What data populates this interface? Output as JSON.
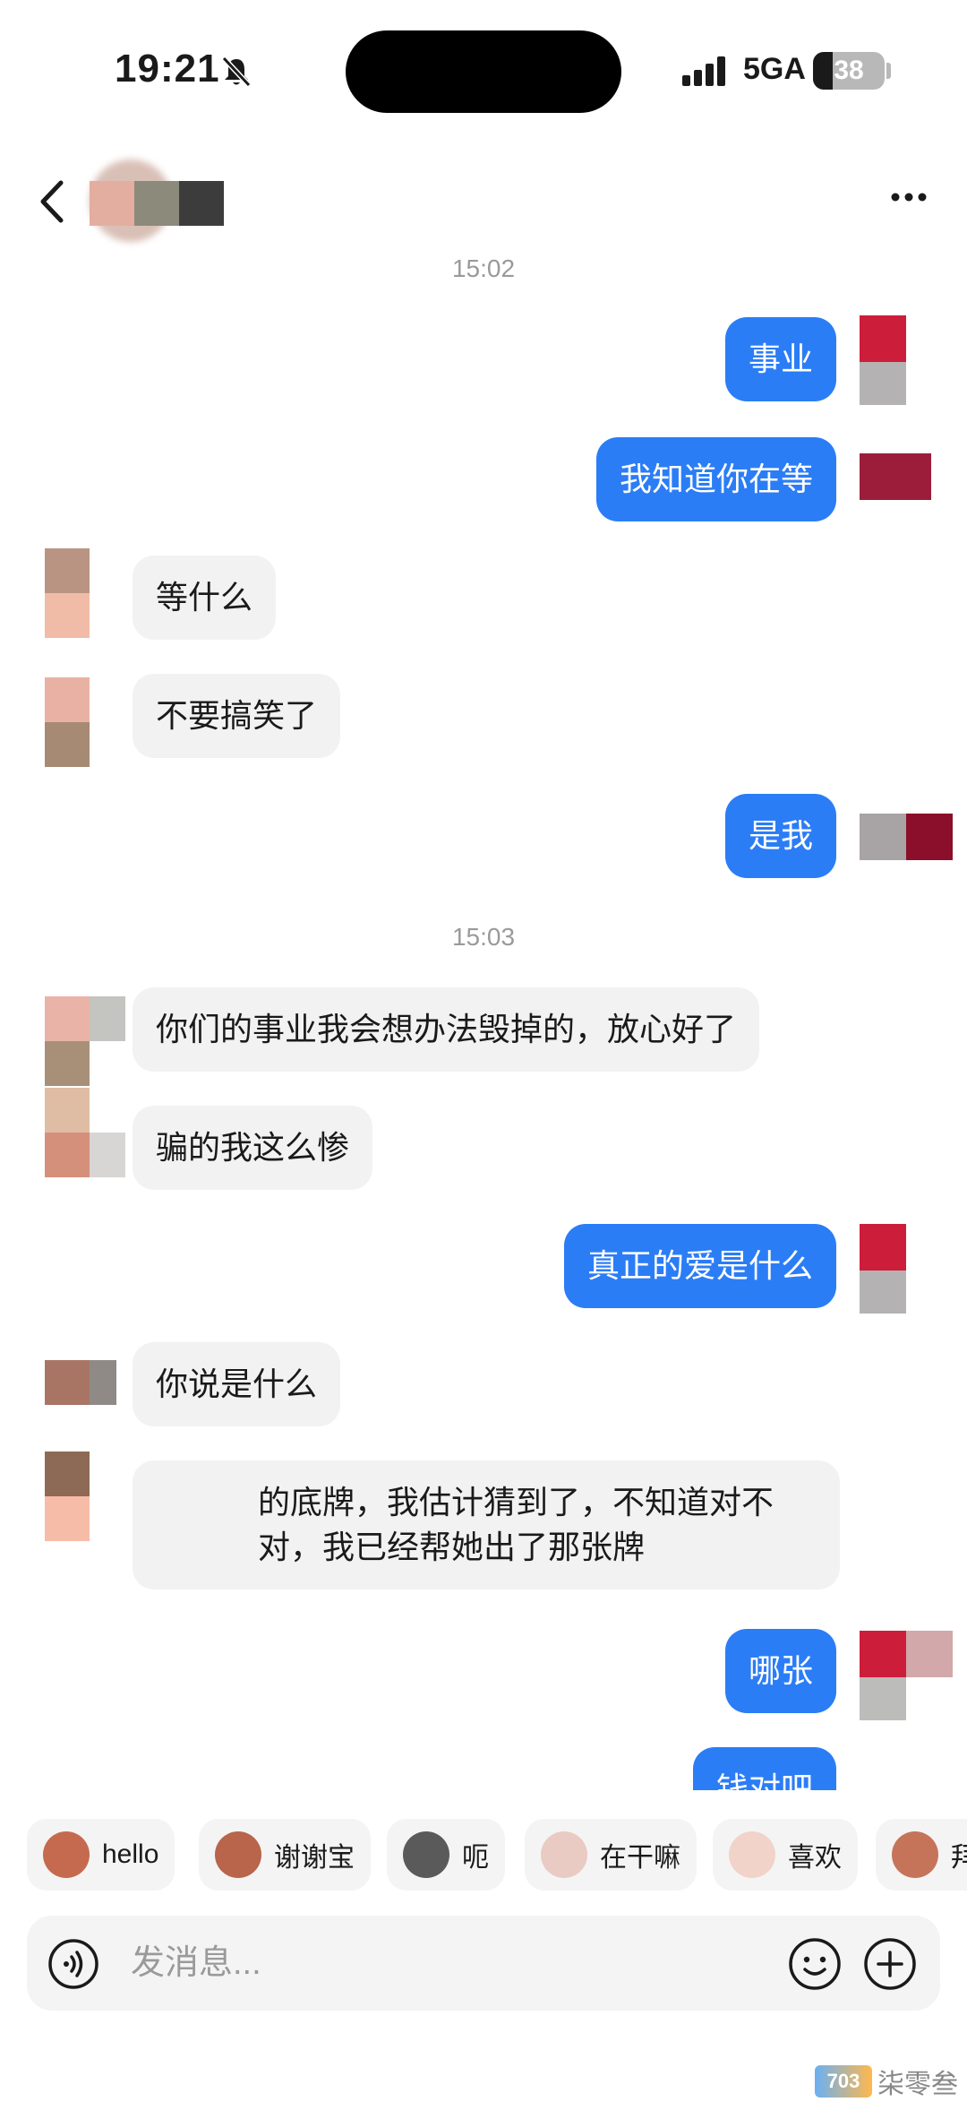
{
  "status": {
    "time": "19:21",
    "network": "5GA",
    "battery": "38"
  },
  "header": {
    "back_icon": "chevron-left-icon",
    "more_icon": "more-dots-icon"
  },
  "chat": {
    "timestamps": [
      "15:02",
      "15:03"
    ],
    "messages": [
      {
        "side": "out",
        "text": "事业"
      },
      {
        "side": "out",
        "text": "我知道你在等"
      },
      {
        "side": "in",
        "text": "等什么"
      },
      {
        "side": "in",
        "text": "不要搞笑了"
      },
      {
        "side": "out",
        "text": "是我"
      },
      {
        "side": "in",
        "text": "你们的事业我会想办法毁掉的，放心好了"
      },
      {
        "side": "in",
        "text": "骗的我这么惨"
      },
      {
        "side": "out",
        "text": "真正的爱是什么"
      },
      {
        "side": "in",
        "text": "你说是什么"
      },
      {
        "side": "in",
        "text": "的底牌，我估计猜到了，不知道对不对，我已经帮她出了那张牌"
      },
      {
        "side": "out",
        "text": "哪张"
      },
      {
        "side": "out",
        "text": "钱对吧"
      }
    ]
  },
  "quick_replies": [
    {
      "label": "hello",
      "icon": "monkey-emoji-icon"
    },
    {
      "label": "谢谢宝",
      "icon": "monkey-flower-emoji-icon"
    },
    {
      "label": "呃",
      "icon": "cat-emoji-icon"
    },
    {
      "label": "在干嘛",
      "icon": "doll-emoji-icon"
    },
    {
      "label": "喜欢",
      "icon": "doll-heart-emoji-icon"
    },
    {
      "label": "拜",
      "icon": "wave-emoji-icon"
    }
  ],
  "composer": {
    "placeholder": "发消息...",
    "voice_icon": "voice-icon",
    "emoji_icon": "smiley-icon",
    "plus_icon": "plus-icon"
  },
  "watermark": {
    "logo": "703",
    "text": "柒零叁"
  }
}
